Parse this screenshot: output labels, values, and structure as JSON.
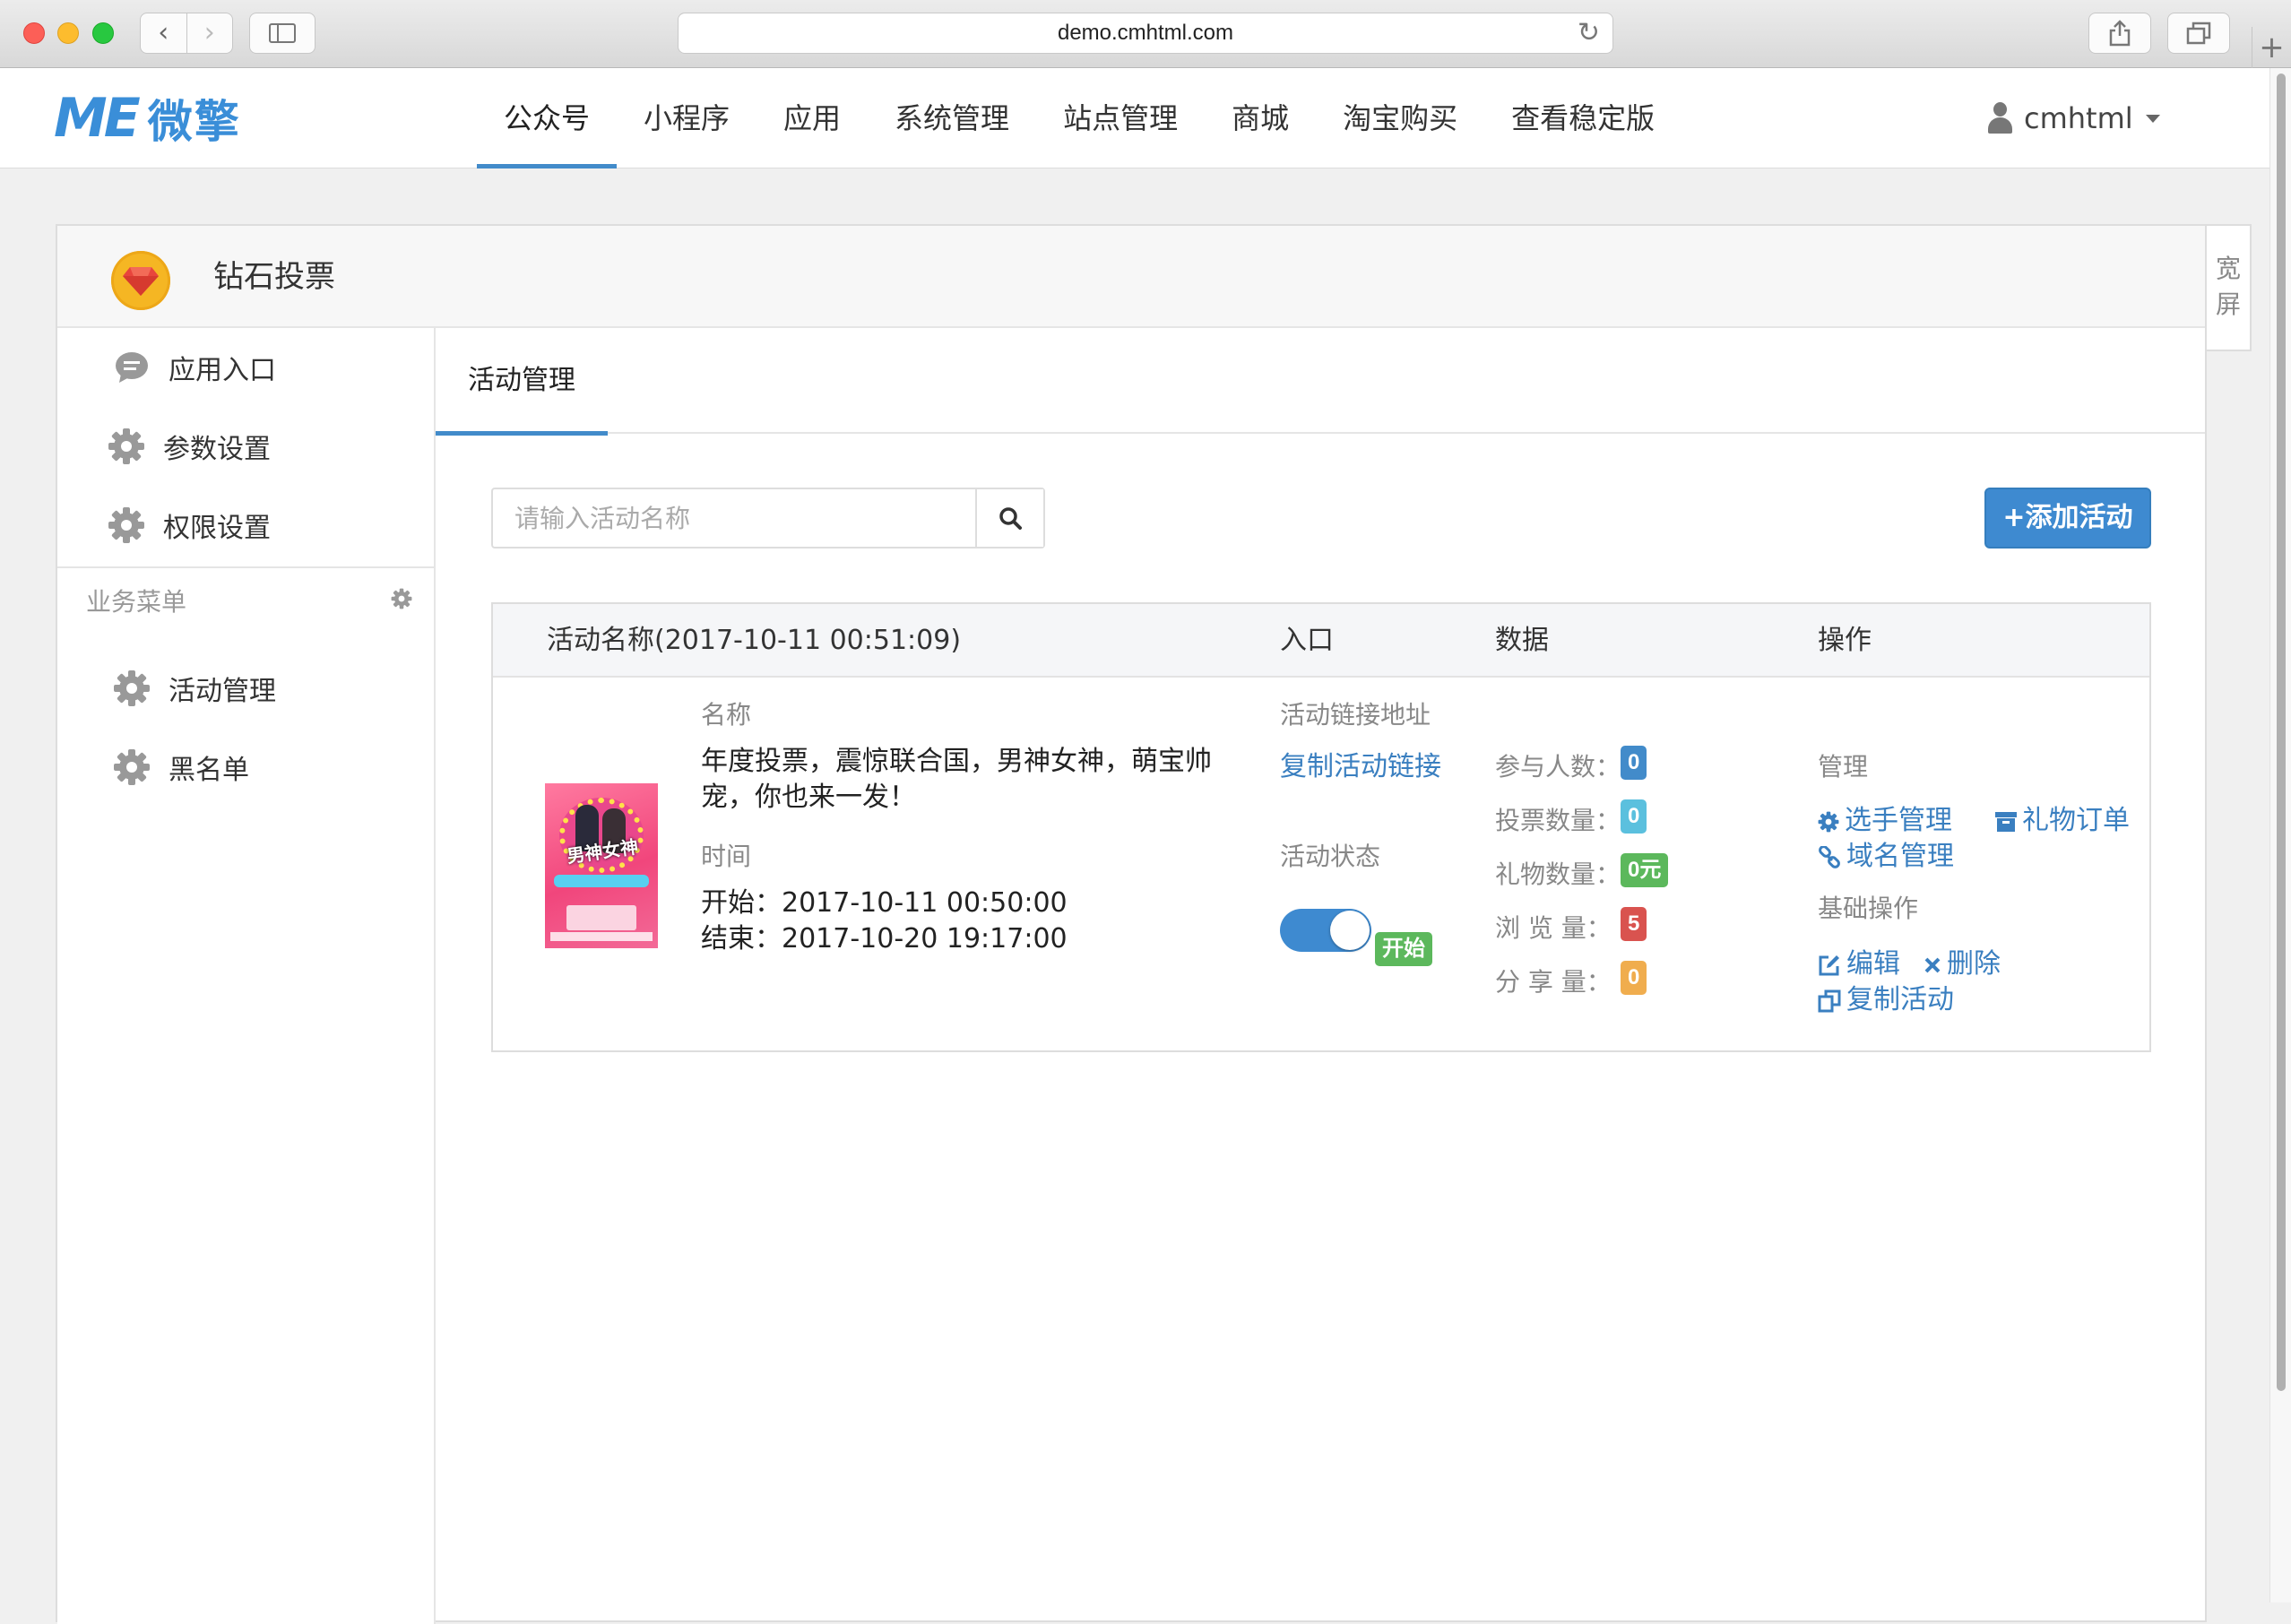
{
  "browser": {
    "url": "demo.cmhtml.com"
  },
  "topnav": {
    "logo_mark": "ME",
    "logo_text": "微擎",
    "items": [
      {
        "label": "公众号",
        "active": true
      },
      {
        "label": "小程序"
      },
      {
        "label": "应用"
      },
      {
        "label": "系统管理"
      },
      {
        "label": "站点管理"
      },
      {
        "label": "商城"
      },
      {
        "label": "淘宝购买"
      },
      {
        "label": "查看稳定版"
      }
    ],
    "user": "cmhtml"
  },
  "app": {
    "title": "钻石投票",
    "wide_toggle": "宽屏"
  },
  "sidebar": {
    "items": [
      {
        "label": "应用入口",
        "icon": "chat-icon"
      },
      {
        "label": "参数设置",
        "icon": "gear-icon"
      },
      {
        "label": "权限设置",
        "icon": "gear-icon"
      }
    ],
    "group_label": "业务菜单",
    "group_items": [
      {
        "label": "活动管理",
        "icon": "gear-icon"
      },
      {
        "label": "黑名单",
        "icon": "gear-icon"
      }
    ]
  },
  "main": {
    "tab": "活动管理",
    "search_placeholder": "请输入活动名称",
    "search_value": "",
    "add_button": "+添加活动",
    "table": {
      "headers": {
        "name": "活动名称(2017-10-11 00:51:09)",
        "entry": "入口",
        "data": "数据",
        "operation": "操作"
      },
      "row": {
        "name_label": "名称",
        "name_line1": "年度投票，震惊联合国，男神女神，萌宝帅",
        "name_line2": "宠，你也来一发！",
        "time_label": "时间",
        "start": "开始：2017-10-11 00:50:00",
        "end": "结束：2017-10-20 19:17:00",
        "poster_text": "男神女神",
        "link_label": "活动链接地址",
        "copy_link": "复制活动链接",
        "status_label": "活动状态",
        "status_on": true,
        "status_badge": "开始",
        "stats": [
          {
            "label": "参与人数：",
            "value": "0",
            "color": "#428bca"
          },
          {
            "label": "投票数量：",
            "value": "0",
            "color": "#5bc0de"
          },
          {
            "label": "礼物数量：",
            "value": "0元",
            "color": "#5cb85c"
          },
          {
            "label": "浏 览 量：",
            "value": "5",
            "color": "#d9534f"
          },
          {
            "label": "分 享 量：",
            "value": "0",
            "color": "#f0ad4e"
          }
        ],
        "manage_label": "管理",
        "manage_links": {
          "players": "选手管理",
          "gift_orders": "礼物订单",
          "domain": "域名管理"
        },
        "basic_label": "基础操作",
        "basic_links": {
          "edit": "编辑",
          "delete": "删除",
          "copy": "复制活动"
        }
      }
    }
  }
}
